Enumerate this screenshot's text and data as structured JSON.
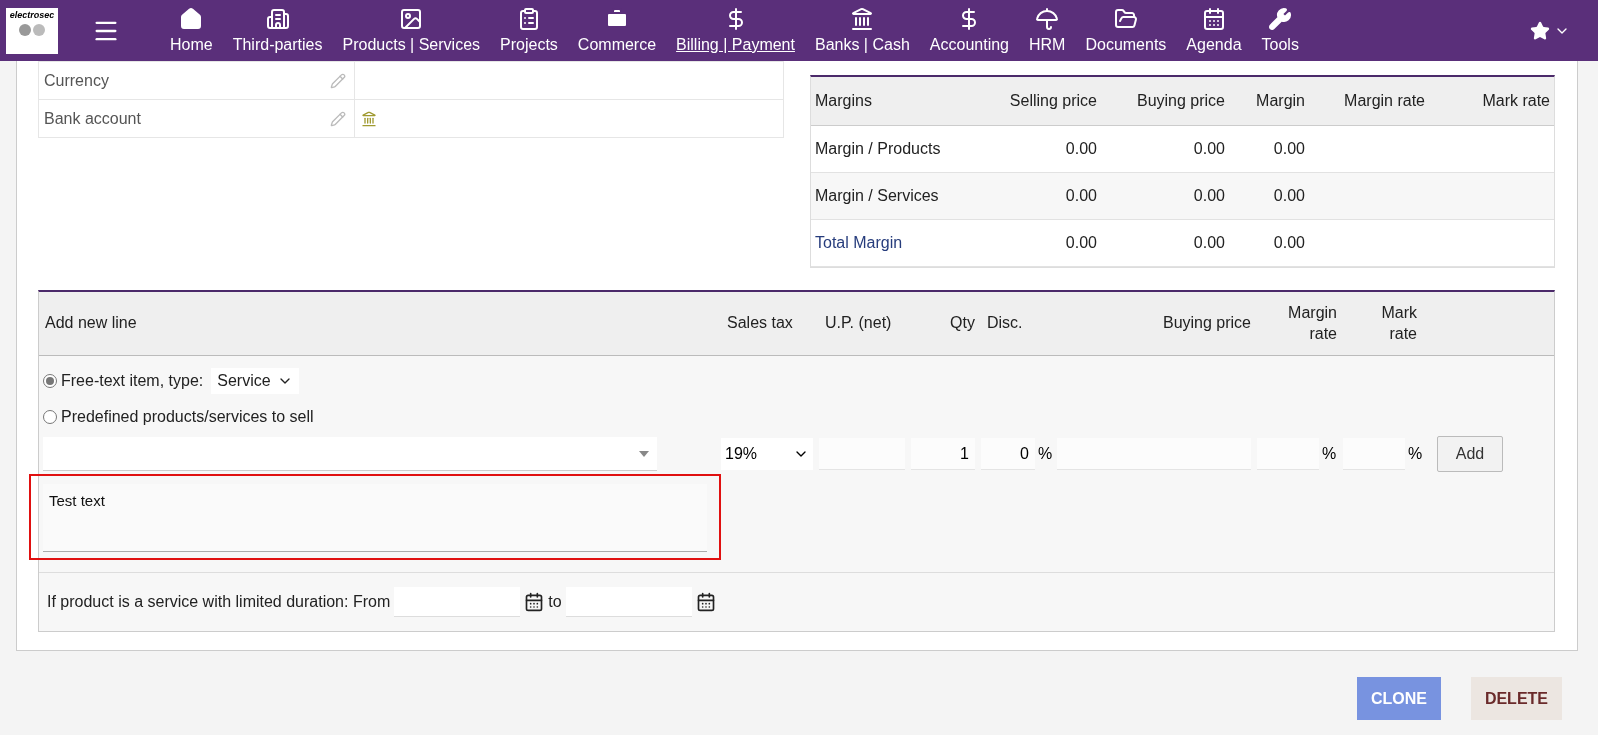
{
  "logo": {
    "text": "electrosec"
  },
  "nav": [
    {
      "label": "Home",
      "selected": false
    },
    {
      "label": "Third-parties",
      "selected": false
    },
    {
      "label": "Products | Services",
      "selected": false
    },
    {
      "label": "Projects",
      "selected": false
    },
    {
      "label": "Commerce",
      "selected": false
    },
    {
      "label": "Billing | Payment",
      "selected": true
    },
    {
      "label": "Banks | Cash",
      "selected": false
    },
    {
      "label": "Accounting",
      "selected": false
    },
    {
      "label": "HRM",
      "selected": false
    },
    {
      "label": "Documents",
      "selected": false
    },
    {
      "label": "Agenda",
      "selected": false
    },
    {
      "label": "Tools",
      "selected": false
    }
  ],
  "details": [
    {
      "label": "Currency"
    },
    {
      "label": "Bank account"
    }
  ],
  "margins": {
    "columns": [
      "Margins",
      "Selling price",
      "Buying price",
      "Margin",
      "Margin rate",
      "Mark rate"
    ],
    "rows": [
      {
        "kind": "item",
        "label": "Margin / Products",
        "values": [
          "0.00",
          "0.00",
          "0.00"
        ]
      },
      {
        "kind": "item",
        "label": "Margin / Services",
        "values": [
          "0.00",
          "0.00",
          "0.00"
        ]
      },
      {
        "kind": "total",
        "label": "Total Margin",
        "values": [
          "0.00",
          "0.00",
          "0.00"
        ]
      }
    ]
  },
  "add_line": {
    "title": "Add new line",
    "columns": [
      {
        "label": "Sales tax"
      },
      {
        "label": "U.P. (net)"
      },
      {
        "label": "Qty"
      },
      {
        "label": "Disc."
      },
      {
        "label": "Buying price"
      },
      {
        "label": "Margin rate"
      },
      {
        "label": "Mark rate"
      }
    ],
    "options": [
      {
        "label": "Free-text item, type:",
        "selected": true
      },
      {
        "label": "Predefined products/services to sell",
        "selected": false
      }
    ],
    "type_select": "Service",
    "description": {
      "value": "Test text",
      "highlighted": true
    },
    "sales_tax": "19%",
    "qty": "1",
    "discount": "0",
    "percent_sign": "%",
    "margin_percent": "%",
    "mark_percent": "%",
    "add_button": "Add",
    "duration": {
      "label": "If product is a service with limited duration: From",
      "to": "to"
    }
  },
  "actions": [
    {
      "label": "CLONE",
      "kind": "primary"
    },
    {
      "label": "DELETE",
      "kind": "danger"
    }
  ]
}
